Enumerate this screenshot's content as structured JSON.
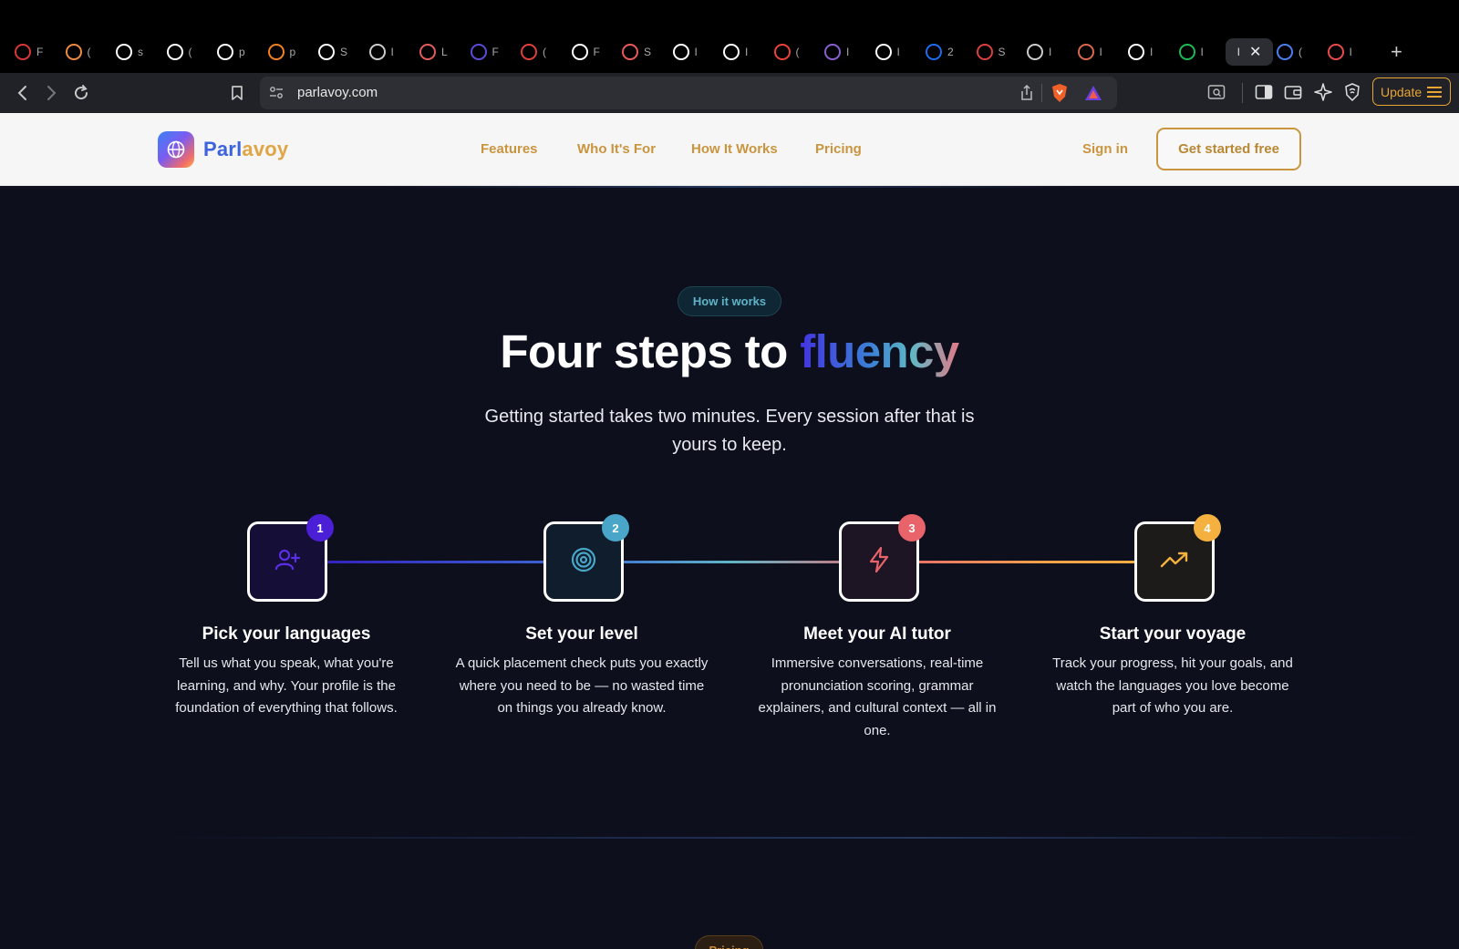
{
  "browser": {
    "tabs": [
      {
        "icon": "red-stack-icon",
        "color": "#d93636",
        "title": "F"
      },
      {
        "icon": "orange-hex-icon",
        "color": "#f08a3c",
        "title": "("
      },
      {
        "icon": "disc-icon",
        "color": "#ffffff",
        "title": "s"
      },
      {
        "icon": "github-icon",
        "color": "#ffffff",
        "title": "("
      },
      {
        "icon": "triangle-icon",
        "color": "#ffffff",
        "title": "p"
      },
      {
        "icon": "cloud-icon",
        "color": "#f48120",
        "title": "p"
      },
      {
        "icon": "square-app-icon",
        "color": "#ffffff",
        "title": "S"
      },
      {
        "icon": "circle-r-icon",
        "color": "#cccccc",
        "title": "I"
      },
      {
        "icon": "image-icon",
        "color": "#e45b5b",
        "title": "L"
      },
      {
        "icon": "purple-box-icon",
        "color": "#5b4bd8",
        "title": "F"
      },
      {
        "icon": "target-icon",
        "color": "#e0403a",
        "title": "("
      },
      {
        "icon": "disc-icon",
        "color": "#ffffff",
        "title": "F"
      },
      {
        "icon": "star-icon",
        "color": "#e85a5a",
        "title": "S"
      },
      {
        "icon": "wix-icon",
        "color": "#ffffff",
        "title": "I"
      },
      {
        "icon": "u-icon",
        "color": "#ffffff",
        "title": "I"
      },
      {
        "icon": "gmail-icon",
        "color": "#ea4335",
        "title": "("
      },
      {
        "icon": "gmail-circle-icon",
        "color": "#8a5fd1",
        "title": "I"
      },
      {
        "icon": "wix-square-icon",
        "color": "#ffffff",
        "title": "I"
      },
      {
        "icon": "zillow-icon",
        "color": "#1a6cf0",
        "title": "2"
      },
      {
        "icon": "hatched-icon",
        "color": "#d94040",
        "title": "S"
      },
      {
        "icon": "globe-icon",
        "color": "#cccccc",
        "title": "I"
      },
      {
        "icon": "sparkle-icon",
        "color": "#d8694a",
        "title": "I"
      },
      {
        "icon": "circle-dot-icon",
        "color": "#ffffff",
        "title": "I"
      },
      {
        "icon": "spotify-icon",
        "color": "#1db954",
        "title": "I"
      }
    ],
    "active_tab": {
      "title": "I",
      "close": "✕"
    },
    "tabs_after": [
      {
        "icon": "translate-icon",
        "color": "#4a7ef0",
        "title": "("
      },
      {
        "icon": "p-icon",
        "color": "#e84a4a",
        "title": "I"
      }
    ],
    "new_tab": "+",
    "url": "parlavoy.com",
    "update_label": "Update"
  },
  "site": {
    "brand_part1": "Parl",
    "brand_part2": "avoy",
    "nav": [
      "Features",
      "Who It's For",
      "How It Works",
      "Pricing"
    ],
    "signin": "Sign in",
    "cta": "Get started free"
  },
  "section": {
    "pill": "How it works",
    "headline_plain": "Four steps to ",
    "headline_accent": "fluency",
    "subtitle": "Getting started takes two minutes. Every session after that is yours to keep.",
    "steps": [
      {
        "number": "1",
        "title": "Pick your languages",
        "description": "Tell us what you speak, what you're learning, and why. Your profile is the foundation of everything that follows.",
        "icon": "user-plus-icon",
        "accent": "#4b1fd6"
      },
      {
        "number": "2",
        "title": "Set your level",
        "description": "A quick placement check puts you exactly where you need to be — no wasted time on things you already know.",
        "icon": "target-rings-icon",
        "accent": "#4aa6c9"
      },
      {
        "number": "3",
        "title": "Meet your AI tutor",
        "description": "Immersive conversations, real-time pronunciation scoring, grammar explainers, and cultural context — all in one.",
        "icon": "lightning-icon",
        "accent": "#e9636a"
      },
      {
        "number": "4",
        "title": "Start your voyage",
        "description": "Track your progress, hit your goals, and watch the languages you love become part of who you are.",
        "icon": "trending-up-icon",
        "accent": "#f4b13f"
      }
    ],
    "next_pill": "Pricing"
  }
}
